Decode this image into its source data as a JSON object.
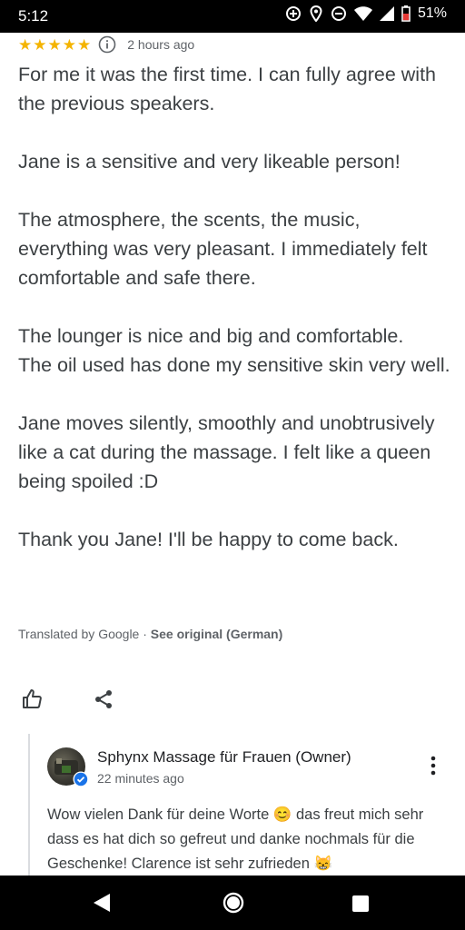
{
  "status_bar": {
    "time": "5:12",
    "battery": "51%",
    "icons": [
      "data-saver-icon",
      "location-icon",
      "do-not-disturb-icon",
      "wifi-icon",
      "signal-icon",
      "battery-icon"
    ]
  },
  "review": {
    "rating": 5,
    "time_ago": "2 hours ago",
    "paragraphs": [
      "For me it was the first time. I can fully agree with the previous speakers.",
      "Jane is a sensitive and very likeable person!",
      "The atmosphere, the scents, the music, everything was very pleasant. I immediately felt comfortable and safe there.",
      "The lounger is nice and big and comfortable.\nThe oil used has done my sensitive skin very well.",
      "Jane moves silently, smoothly and unobtrusively like a cat during the massage. I felt like a queen being spoiled :D",
      "Thank you Jane! I'll be happy to come back."
    ],
    "translated_by": "Translated by Google · ",
    "see_original": "See original (German)"
  },
  "actions": {
    "icons": [
      "thumbs-up-icon",
      "share-icon"
    ]
  },
  "owner_reply": {
    "name": "Sphynx Massage für Frauen (Owner)",
    "time_ago": "22 minutes ago",
    "text": "Wow vielen Dank für deine Worte 😊 das freut mich sehr dass es hat dich so gefreut und danke nochmals für die Geschenke! Clarence ist sehr zufrieden 😸"
  },
  "colors": {
    "star": "#f4b400",
    "text": "#3c4043",
    "secondary": "#5f6368",
    "verified": "#1a73e8"
  }
}
